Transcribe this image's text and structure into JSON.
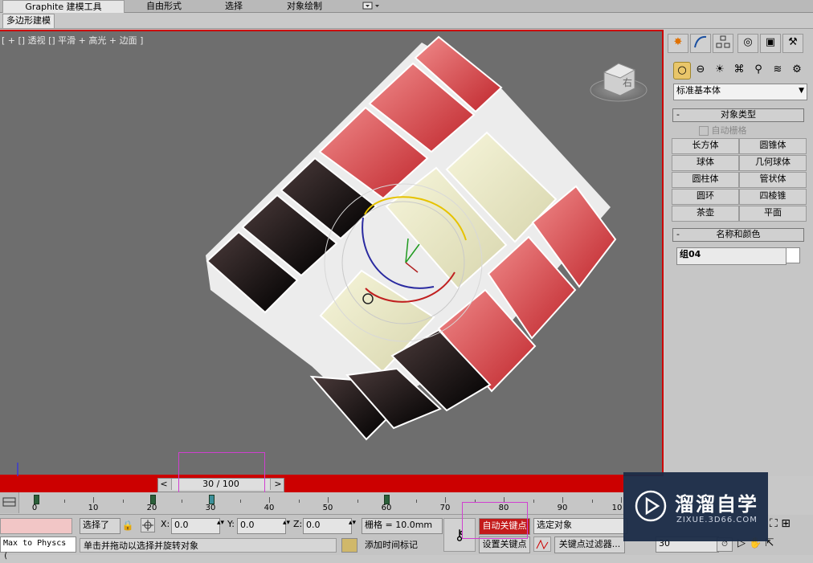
{
  "ribbon": {
    "tabs": [
      "Graphite 建模工具",
      "自由形式",
      "选择",
      "对象绘制"
    ],
    "subtab": "多边形建模"
  },
  "viewport": {
    "label": "[ + [] 透视 [] 平滑 + 高光 + 边面 ]",
    "viewcube_label": "右"
  },
  "time_slider": {
    "left_arrow": "<",
    "right_arrow": ">",
    "value": "30 / 100"
  },
  "trackbar": {
    "labels": [
      "0",
      "10",
      "20",
      "30",
      "40",
      "50",
      "60",
      "70",
      "80",
      "90",
      "10"
    ]
  },
  "status": {
    "selection": "选择了",
    "x_label": "X:",
    "x_value": "0.0",
    "y_label": "Y:",
    "y_value": "0.0",
    "z_label": "Z:",
    "z_value": "0.0",
    "grid": "栅格 = 10.0mm",
    "auto_key": "自动关键点",
    "set_key": "设置关键点",
    "selected_object": "选定对象",
    "key_filters": "关键点过滤器...",
    "prompt": "单击并拖动以选择并旋转对象",
    "add_time_tag": "添加时间标记",
    "frame": "30",
    "maxscript": "Max to Physcs ("
  },
  "command_panel": {
    "dropdown": "标准基本体",
    "object_type_title": "对象类型",
    "autogrid": "自动栅格",
    "buttons": [
      "长方体",
      "圆锥体",
      "球体",
      "几何球体",
      "圆柱体",
      "管状体",
      "圆环",
      "四棱锥",
      "茶壶",
      "平面"
    ],
    "name_color_title": "名称和颜色",
    "object_name": "组04"
  },
  "watermark": {
    "title": "溜溜自学",
    "url": "ZIXUE.3D66.COM"
  },
  "colors": {
    "viewport_border": "#cc0000",
    "red_tile": "#d94a4a",
    "cream_tile": "#eae9c6",
    "black_tile": "#111111"
  }
}
